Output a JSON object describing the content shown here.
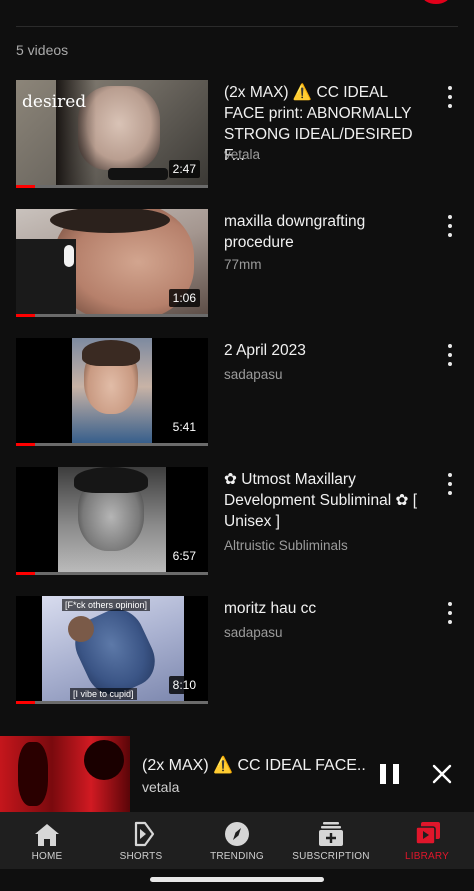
{
  "playlist": {
    "video_count": "5 videos"
  },
  "videos": [
    {
      "title": "(2x MAX) ⚠️ CC IDEAL FACE print: ABNORMALLY STRONG IDEAL/DESIRED F...",
      "channel": "vetala",
      "duration": "2:47",
      "progress": 0.1,
      "overlay_text": "desired"
    },
    {
      "title": "maxilla downgrafting procedure",
      "channel": "77mm",
      "duration": "1:06",
      "progress": 0.1
    },
    {
      "title": "2 April 2023",
      "channel": "sadapasu",
      "duration": "5:41",
      "progress": 0.1
    },
    {
      "title": "✿ Utmost Maxillary Development Subliminal ✿ [ Unisex ]",
      "channel": "Altruistic Subliminals",
      "duration": "6:57",
      "progress": 0.1
    },
    {
      "title": "moritz hau cc",
      "channel": "sadapasu",
      "duration": "8:10",
      "progress": 0.1,
      "overlay_top": "[F*ck others opinion]",
      "overlay_bottom": "[I vibe to cupid]"
    }
  ],
  "mini_player": {
    "title": "(2x MAX) ⚠️ CC IDEAL FACE..",
    "channel": "vetala"
  },
  "nav": {
    "home": "HOME",
    "shorts": "SHORTS",
    "trending": "TRENDING",
    "subscription": "SUBSCRIPTION",
    "library": "LIBRARY"
  },
  "colors": {
    "accent": "#ff0000",
    "active_nav": "#e0162b",
    "background": "#0f0f0f"
  }
}
